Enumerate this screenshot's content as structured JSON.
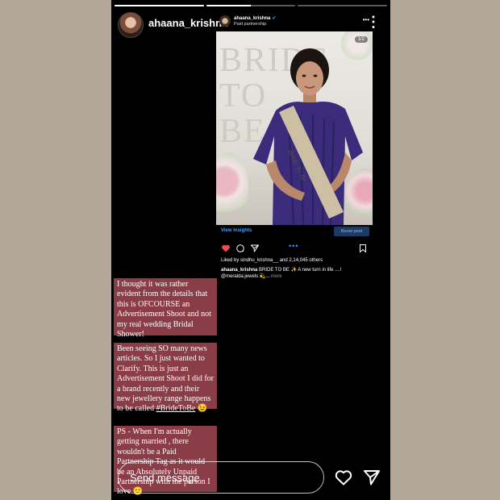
{
  "story": {
    "username": "ahaana_krishna",
    "progress": [
      1,
      0.5,
      0
    ],
    "more_label": "⋮"
  },
  "post": {
    "username": "ahaana_krishna",
    "subtitle": "Paid partnership",
    "counter": "1/2",
    "photo_text": "BRIDE TO BE",
    "sash_text": "Bride To Be",
    "insights_label": "View Insights",
    "boost_label": "Boost post",
    "likes_text": "Liked by sindhu_krishna__ and 2,14,045 others",
    "caption_user": "ahaana_krishna",
    "caption_text": "BRIDE TO BE ✨ A new turn in life ....!",
    "caption_line2": "@meralda.jewels 💫...",
    "caption_more": "more"
  },
  "text_blocks": [
    "I thought it was rather evident from the details that this is OFCOURSE an Advertisement Shoot and not my real wedding Bridal Shower!",
    "Been seeing SO many news articles. So I just wanted to Clarify. This is just an Advertisement Shoot I did for a brand recently and their new jewellery range happens to be called",
    "PS - When I'm actually getting married , there wouldn't be a Paid Partnership Tag as it would be an Absolutely Unpaid Partnership with the person I love 🙂"
  ],
  "hashtag": "#BrideToBe",
  "hashtag_emoji": "😉",
  "reply": {
    "placeholder": "Send message"
  },
  "colors": {
    "background": "#b2a798",
    "text_block": "#8a3d46",
    "link_blue": "#4a9cff",
    "like_red": "#ed4956"
  }
}
